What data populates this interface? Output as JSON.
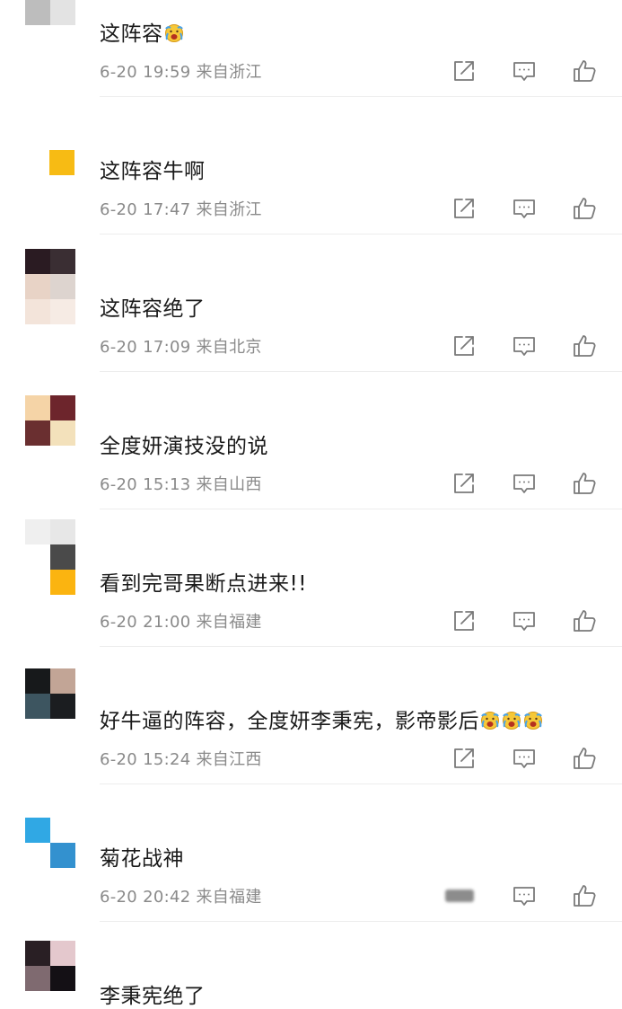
{
  "comments": [
    {
      "text": "这阵容",
      "emojis": 1,
      "time": "6-20 19:59",
      "location": "来自浙江",
      "avatar": [
        "#0d0d0d",
        "#0d0d0d",
        "#bdbdbd",
        "#e3e3e3"
      ]
    },
    {
      "text": "这阵容牛啊",
      "emojis": 0,
      "time": "6-20 17:47",
      "location": "来自浙江",
      "avatar": [
        "#f7bb14"
      ]
    },
    {
      "text": "这阵容绝了",
      "emojis": 0,
      "time": "6-20 17:09",
      "location": "来自北京",
      "avatar": [
        "#2a1b22",
        "#3a2e33",
        "#e8d3c6",
        "#ddd4cf",
        "#f3e4da",
        "#f6ebe4"
      ]
    },
    {
      "text": "全度妍演技没的说",
      "emojis": 0,
      "time": "6-20 15:13",
      "location": "来自山西",
      "avatar": [
        "#f5d4a7",
        "#6d252c",
        "#6a2f30",
        "#f3e1bb"
      ]
    },
    {
      "text": "看到完哥果断点进来!!",
      "emojis": 0,
      "time": "6-20 21:00",
      "location": "来自福建",
      "avatar": [
        "#efefef",
        "#e7e7e7",
        "#ffffff",
        "#4a4a4a",
        "#ffffff",
        "#fbb410"
      ]
    },
    {
      "text": "好牛逼的阵容，全度妍李秉宪，影帝影后",
      "emojis": 3,
      "time": "6-20 15:24",
      "location": "来自江西",
      "avatar": [
        "#17191b",
        "#c2a596",
        "#3d5560",
        "#1b1d20"
      ]
    },
    {
      "text": "菊花战神",
      "emojis": 0,
      "time": "6-20 20:42",
      "location": "来自福建",
      "avatar": [
        "#30a8e4",
        "#ffffff",
        "#ffffff",
        "#3391cf"
      ]
    },
    {
      "text": "李秉宪绝了",
      "emojis": 0,
      "time": "",
      "location": "",
      "avatar": [
        "#291f24",
        "#e4c8cd",
        "#7f6a70",
        "#141015"
      ]
    }
  ],
  "icons": [
    "share-icon",
    "comment-icon",
    "like-icon"
  ],
  "colors": {
    "text": "#1a1a1a",
    "meta": "#8a8a8a",
    "icon": "#7a7a7a",
    "divider": "#ededed"
  }
}
